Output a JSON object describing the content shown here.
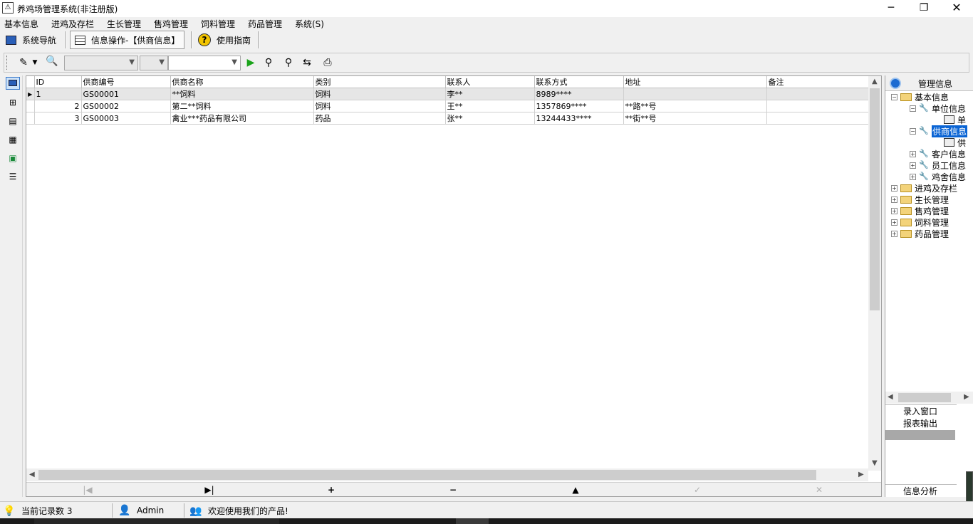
{
  "window": {
    "title": "养鸡场管理系统(非注册版)",
    "icon": "app-icon",
    "controls": [
      "minimize",
      "maximize",
      "close"
    ]
  },
  "menu": [
    "基本信息",
    "进鸡及存栏",
    "生长管理",
    "售鸡管理",
    "饲料管理",
    "药品管理",
    "系统(S)"
  ],
  "tabs": [
    {
      "label": "系统导航",
      "icon": "monitor-icon",
      "active": false
    },
    {
      "label": "信息操作-【供商信息】",
      "icon": "table-icon",
      "active": true
    },
    {
      "label": "使用指南",
      "icon": "help-icon",
      "active": false
    }
  ],
  "toolbar": {
    "icons": [
      "edit-pencil-icon",
      "preview-icon",
      "find-icon",
      "find-next-icon",
      "refresh-icon",
      "print-icon"
    ],
    "run_icon": "run-green-arrow-icon",
    "combo1_value": "",
    "combo2_value": "",
    "combo3_value": ""
  },
  "left_toolbar": [
    "grid-view-icon",
    "tree-view-icon",
    "list-view-icon",
    "document-icon",
    "chart-icon",
    "report-icon"
  ],
  "grid": {
    "columns": [
      "ID",
      "供商编号",
      "供商名称",
      "类别",
      "联系人",
      "联系方式",
      "地址",
      "备注"
    ],
    "rows": [
      {
        "id": "1",
        "code": "GS00001",
        "name": "**饲料",
        "category": "饲料",
        "contact": "李**",
        "phone": "8989****",
        "address": "",
        "note": ""
      },
      {
        "id": "2",
        "code": "GS00002",
        "name": "第二**饲料",
        "category": "饲料",
        "contact": "王**",
        "phone": "1357869****",
        "address": "**路**号",
        "note": ""
      },
      {
        "id": "3",
        "code": "GS00003",
        "name": "禽业***药品有限公司",
        "category": "药品",
        "contact": "张**",
        "phone": "13244433****",
        "address": "**街**号",
        "note": ""
      }
    ],
    "current_row": 0
  },
  "navigator": [
    "first",
    "last",
    "insert",
    "delete",
    "post-up",
    "edit",
    "cancel"
  ],
  "right_panel": {
    "title": "管理信息",
    "tree": [
      {
        "label": "基本信息",
        "level": 0,
        "expanded": true,
        "type": "folder"
      },
      {
        "label": "单位信息",
        "level": 1,
        "expanded": true,
        "type": "tool"
      },
      {
        "label": "单",
        "level": 2,
        "type": "leaf"
      },
      {
        "label": "供商信息",
        "level": 1,
        "expanded": true,
        "type": "tool",
        "selected": true
      },
      {
        "label": "供",
        "level": 2,
        "type": "leaf"
      },
      {
        "label": "客户信息",
        "level": 1,
        "expanded": false,
        "type": "tool"
      },
      {
        "label": "员工信息",
        "level": 1,
        "expanded": false,
        "type": "tool"
      },
      {
        "label": "鸡舍信息",
        "level": 1,
        "expanded": false,
        "type": "tool"
      },
      {
        "label": "进鸡及存栏",
        "level": 0,
        "expanded": false,
        "type": "folder"
      },
      {
        "label": "生长管理",
        "level": 0,
        "expanded": false,
        "type": "folder"
      },
      {
        "label": "售鸡管理",
        "level": 0,
        "expanded": false,
        "type": "folder"
      },
      {
        "label": "饲料管理",
        "level": 0,
        "expanded": false,
        "type": "folder"
      },
      {
        "label": "药品管理",
        "level": 0,
        "expanded": false,
        "type": "folder"
      }
    ],
    "buttons": [
      "录入窗口",
      "报表输出"
    ],
    "analysis": "信息分析"
  },
  "status": {
    "record_count_label": "当前记录数 3",
    "user": "Admin",
    "message": "欢迎使用我们的产品!"
  }
}
